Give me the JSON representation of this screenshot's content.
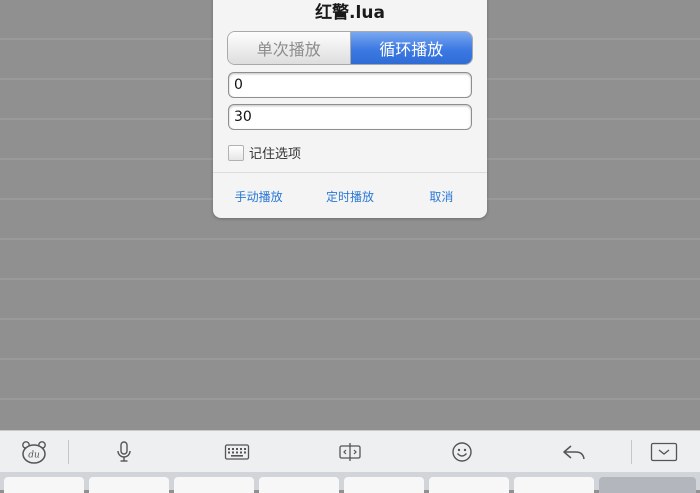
{
  "dialog": {
    "title": "红警.lua",
    "segments": [
      {
        "label": "单次播放",
        "selected": false
      },
      {
        "label": "循环播放",
        "selected": true
      }
    ],
    "field_1": {
      "value": "0"
    },
    "field_2": {
      "value": "30"
    },
    "remember": {
      "label": "记住选项",
      "checked": false
    },
    "actions": [
      {
        "label": "手动播放"
      },
      {
        "label": "定时播放"
      },
      {
        "label": "取消"
      }
    ]
  },
  "keyboard_toolbar": {
    "items": [
      {
        "icon": "baidu-du-icon"
      },
      {
        "icon": "microphone-icon"
      },
      {
        "icon": "keyboard-icon"
      },
      {
        "icon": "cursor-move-icon"
      },
      {
        "icon": "emoji-smile-icon"
      },
      {
        "icon": "undo-arrow-icon"
      },
      {
        "icon": "hide-keyboard-icon"
      }
    ]
  },
  "colors": {
    "accent_blue": "#3c79e2",
    "action_text": "#2a78d6",
    "backdrop": "#909090"
  }
}
